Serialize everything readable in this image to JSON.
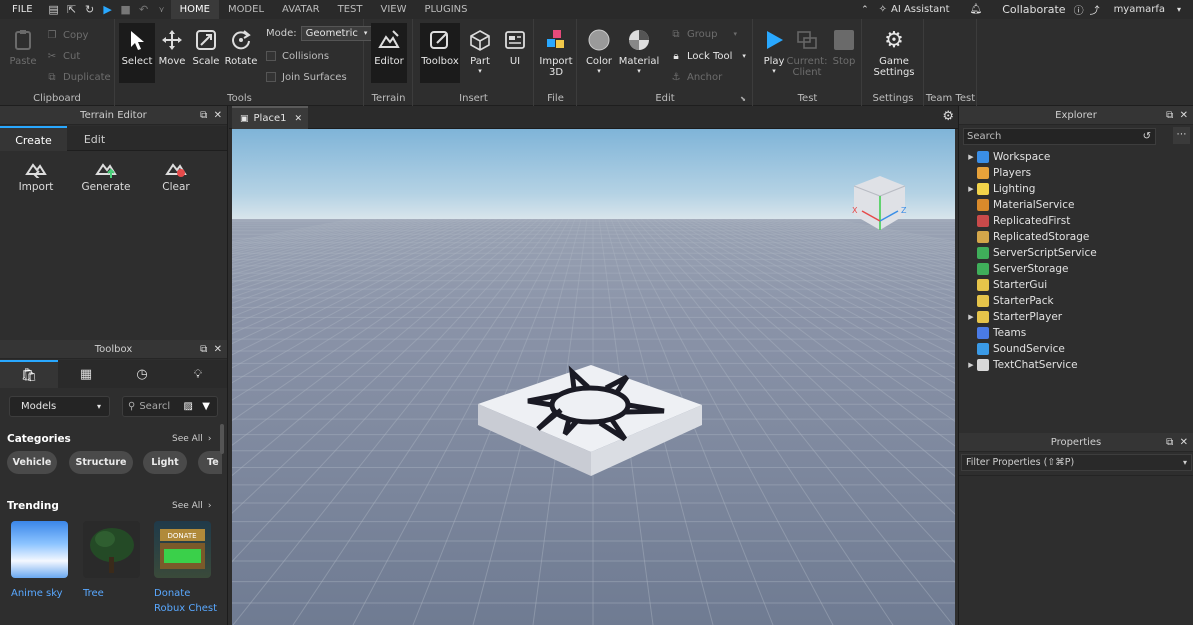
{
  "menubar": {
    "file": "FILE",
    "tabs": [
      "HOME",
      "MODEL",
      "AVATAR",
      "TEST",
      "VIEW",
      "PLUGINS"
    ],
    "ai_assistant": "AI Assistant",
    "collaborate": "Collaborate",
    "username": "myamarfa"
  },
  "ribbon": {
    "clipboard": {
      "label": "Clipboard",
      "paste": "Paste",
      "copy": "Copy",
      "cut": "Cut",
      "duplicate": "Duplicate"
    },
    "tools": {
      "label": "Tools",
      "select": "Select",
      "move": "Move",
      "scale": "Scale",
      "rotate": "Rotate",
      "mode_label": "Mode:",
      "mode_value": "Geometric",
      "collisions": "Collisions",
      "join_surfaces": "Join Surfaces"
    },
    "terrain": {
      "label": "Terrain",
      "editor": "Editor"
    },
    "insert": {
      "label": "Insert",
      "toolbox": "Toolbox",
      "part": "Part",
      "ui": "UI"
    },
    "file": {
      "label": "File",
      "import3d_1": "Import",
      "import3d_2": "3D"
    },
    "edit": {
      "label": "Edit",
      "color": "Color",
      "material": "Material",
      "group": "Group",
      "lock_tool": "Lock Tool",
      "anchor": "Anchor"
    },
    "test": {
      "label": "Test",
      "play": "Play",
      "current1": "Current:",
      "current2": "Client",
      "stop": "Stop"
    },
    "settings": {
      "label": "Settings",
      "game1": "Game",
      "game2": "Settings"
    },
    "team_test": {
      "label": "Team Test"
    }
  },
  "terrain_editor": {
    "title": "Terrain Editor",
    "tabs": [
      "Create",
      "Edit"
    ],
    "actions": [
      "Import",
      "Generate",
      "Clear"
    ]
  },
  "toolbox": {
    "title": "Toolbox",
    "category_select": "Models",
    "search_placeholder": "Searcl",
    "categories_title": "Categories",
    "see_all": "See All",
    "chips": [
      "Vehicle",
      "Structure",
      "Light",
      "Te"
    ],
    "trending_title": "Trending",
    "trending": [
      {
        "name": "Anime sky"
      },
      {
        "name": "Tree"
      },
      {
        "name": "Donate",
        "name2": "Robux Chest"
      }
    ]
  },
  "document": {
    "tab": "Place1"
  },
  "explorer": {
    "title": "Explorer",
    "search_placeholder": "Search",
    "items": [
      {
        "name": "Workspace",
        "expand": true,
        "color": "#3a8ee6"
      },
      {
        "name": "Players",
        "expand": false,
        "color": "#e8a23a"
      },
      {
        "name": "Lighting",
        "expand": true,
        "color": "#f2d34a"
      },
      {
        "name": "MaterialService",
        "expand": false,
        "color": "#d98a2b"
      },
      {
        "name": "ReplicatedFirst",
        "expand": false,
        "color": "#c94a4a"
      },
      {
        "name": "ReplicatedStorage",
        "expand": false,
        "color": "#d4a64a"
      },
      {
        "name": "ServerScriptService",
        "expand": false,
        "color": "#3fae5a"
      },
      {
        "name": "ServerStorage",
        "expand": false,
        "color": "#3fae5a"
      },
      {
        "name": "StarterGui",
        "expand": false,
        "color": "#e6c44a"
      },
      {
        "name": "StarterPack",
        "expand": false,
        "color": "#e6c44a"
      },
      {
        "name": "StarterPlayer",
        "expand": true,
        "color": "#e6c44a"
      },
      {
        "name": "Teams",
        "expand": false,
        "color": "#4a7be6"
      },
      {
        "name": "SoundService",
        "expand": false,
        "color": "#3a9ae6"
      },
      {
        "name": "TextChatService",
        "expand": true,
        "color": "#d8d8d8"
      }
    ]
  },
  "properties": {
    "title": "Properties",
    "filter_placeholder": "Filter Properties (⇧⌘P)"
  }
}
